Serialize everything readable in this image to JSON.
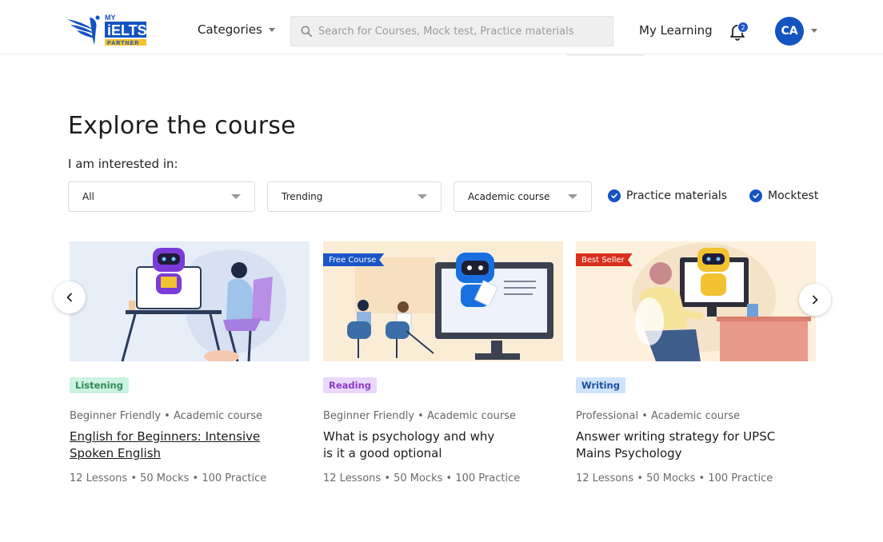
{
  "header": {
    "logo_text": {
      "line1": "MY",
      "line2": "iELTS",
      "line3": "PARTNER"
    },
    "categories_label": "Categories",
    "search_placeholder": "Search for Courses, Mock test, Practice materials",
    "my_learning_label": "My Learning",
    "notification_count": "2",
    "avatar_initials": "CA"
  },
  "main": {
    "title": "Explore the course",
    "interested_label": "I am interested in:",
    "filters": [
      {
        "value": "All"
      },
      {
        "value": "Trending"
      },
      {
        "value": "Academic course"
      }
    ],
    "checkboxes": [
      {
        "label": "Practice materials",
        "checked": true
      },
      {
        "label": "Mocktest",
        "checked": true
      }
    ]
  },
  "courses": [
    {
      "ribbon": "",
      "tag": "Listening",
      "tag_color": "#2e8b57",
      "tag_bg": "#cdf2e1",
      "meta": "Beginner Friendly • Academic course",
      "title": "English for Beginners: Intensive Spoken English",
      "stats": "12 Lessons • 50 Mocks • 100 Practice"
    },
    {
      "ribbon": "Free Course",
      "ribbon_color": "#1a56c7",
      "tag": "Reading",
      "tag_color": "#8a3bc7",
      "tag_bg": "#ead7fb",
      "meta": "Beginner Friendly • Academic course",
      "title": "What is psychology and why is it a good optional",
      "stats": "12 Lessons • 50 Mocks • 100 Practice"
    },
    {
      "ribbon": "Best Seller",
      "ribbon_color": "#d8301e",
      "tag": "Writing",
      "tag_color": "#1c4f9e",
      "tag_bg": "#cfe3fb",
      "meta": "Professional • Academic course",
      "title": "Answer writing strategy for UPSC Mains Psychology",
      "stats": "12 Lessons • 50 Mocks • 100 Practice"
    }
  ],
  "colors": {
    "brand": "#1453c2",
    "accent_yellow": "#f2c230"
  },
  "icons": [
    "logo-icon",
    "chevron-down-icon",
    "search-icon",
    "bell-icon",
    "check-icon",
    "chevron-left-icon",
    "chevron-right-icon"
  ]
}
